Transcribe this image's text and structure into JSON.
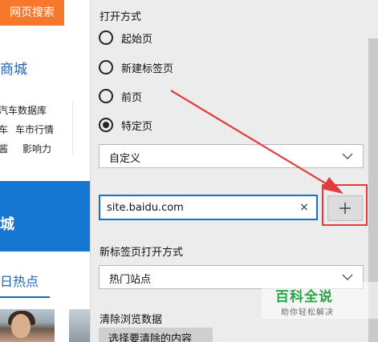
{
  "background_page": {
    "search_button": "网页搜索",
    "mall": "商城",
    "links": [
      "汽车数据库",
      "车",
      "车市行情",
      "酱",
      "影响力"
    ],
    "banner_char": "城",
    "hot": "日热点"
  },
  "settings": {
    "open_with_title": "打开方式",
    "radio_options": [
      {
        "label": "起始页",
        "checked": false
      },
      {
        "label": "新建标签页",
        "checked": false
      },
      {
        "label": "前页",
        "checked": false
      },
      {
        "label": "特定页",
        "checked": true
      }
    ],
    "custom_select_value": "自定义",
    "url_value": "site.baidu.com",
    "clear_icon": "×",
    "newtab_title": "新标签页打开方式",
    "newtab_select_value": "热门站点",
    "clear_data_title": "清除浏览数据",
    "choose_clear_button": "选择要清除的内容"
  },
  "watermark": {
    "title": "百科全说",
    "subtitle": "助你轻松解决"
  },
  "colors": {
    "accent_blue": "#1a6fd4",
    "annotation_red": "#e33b3b",
    "search_orange": "#f7782b",
    "watermark_green": "#28a745"
  }
}
